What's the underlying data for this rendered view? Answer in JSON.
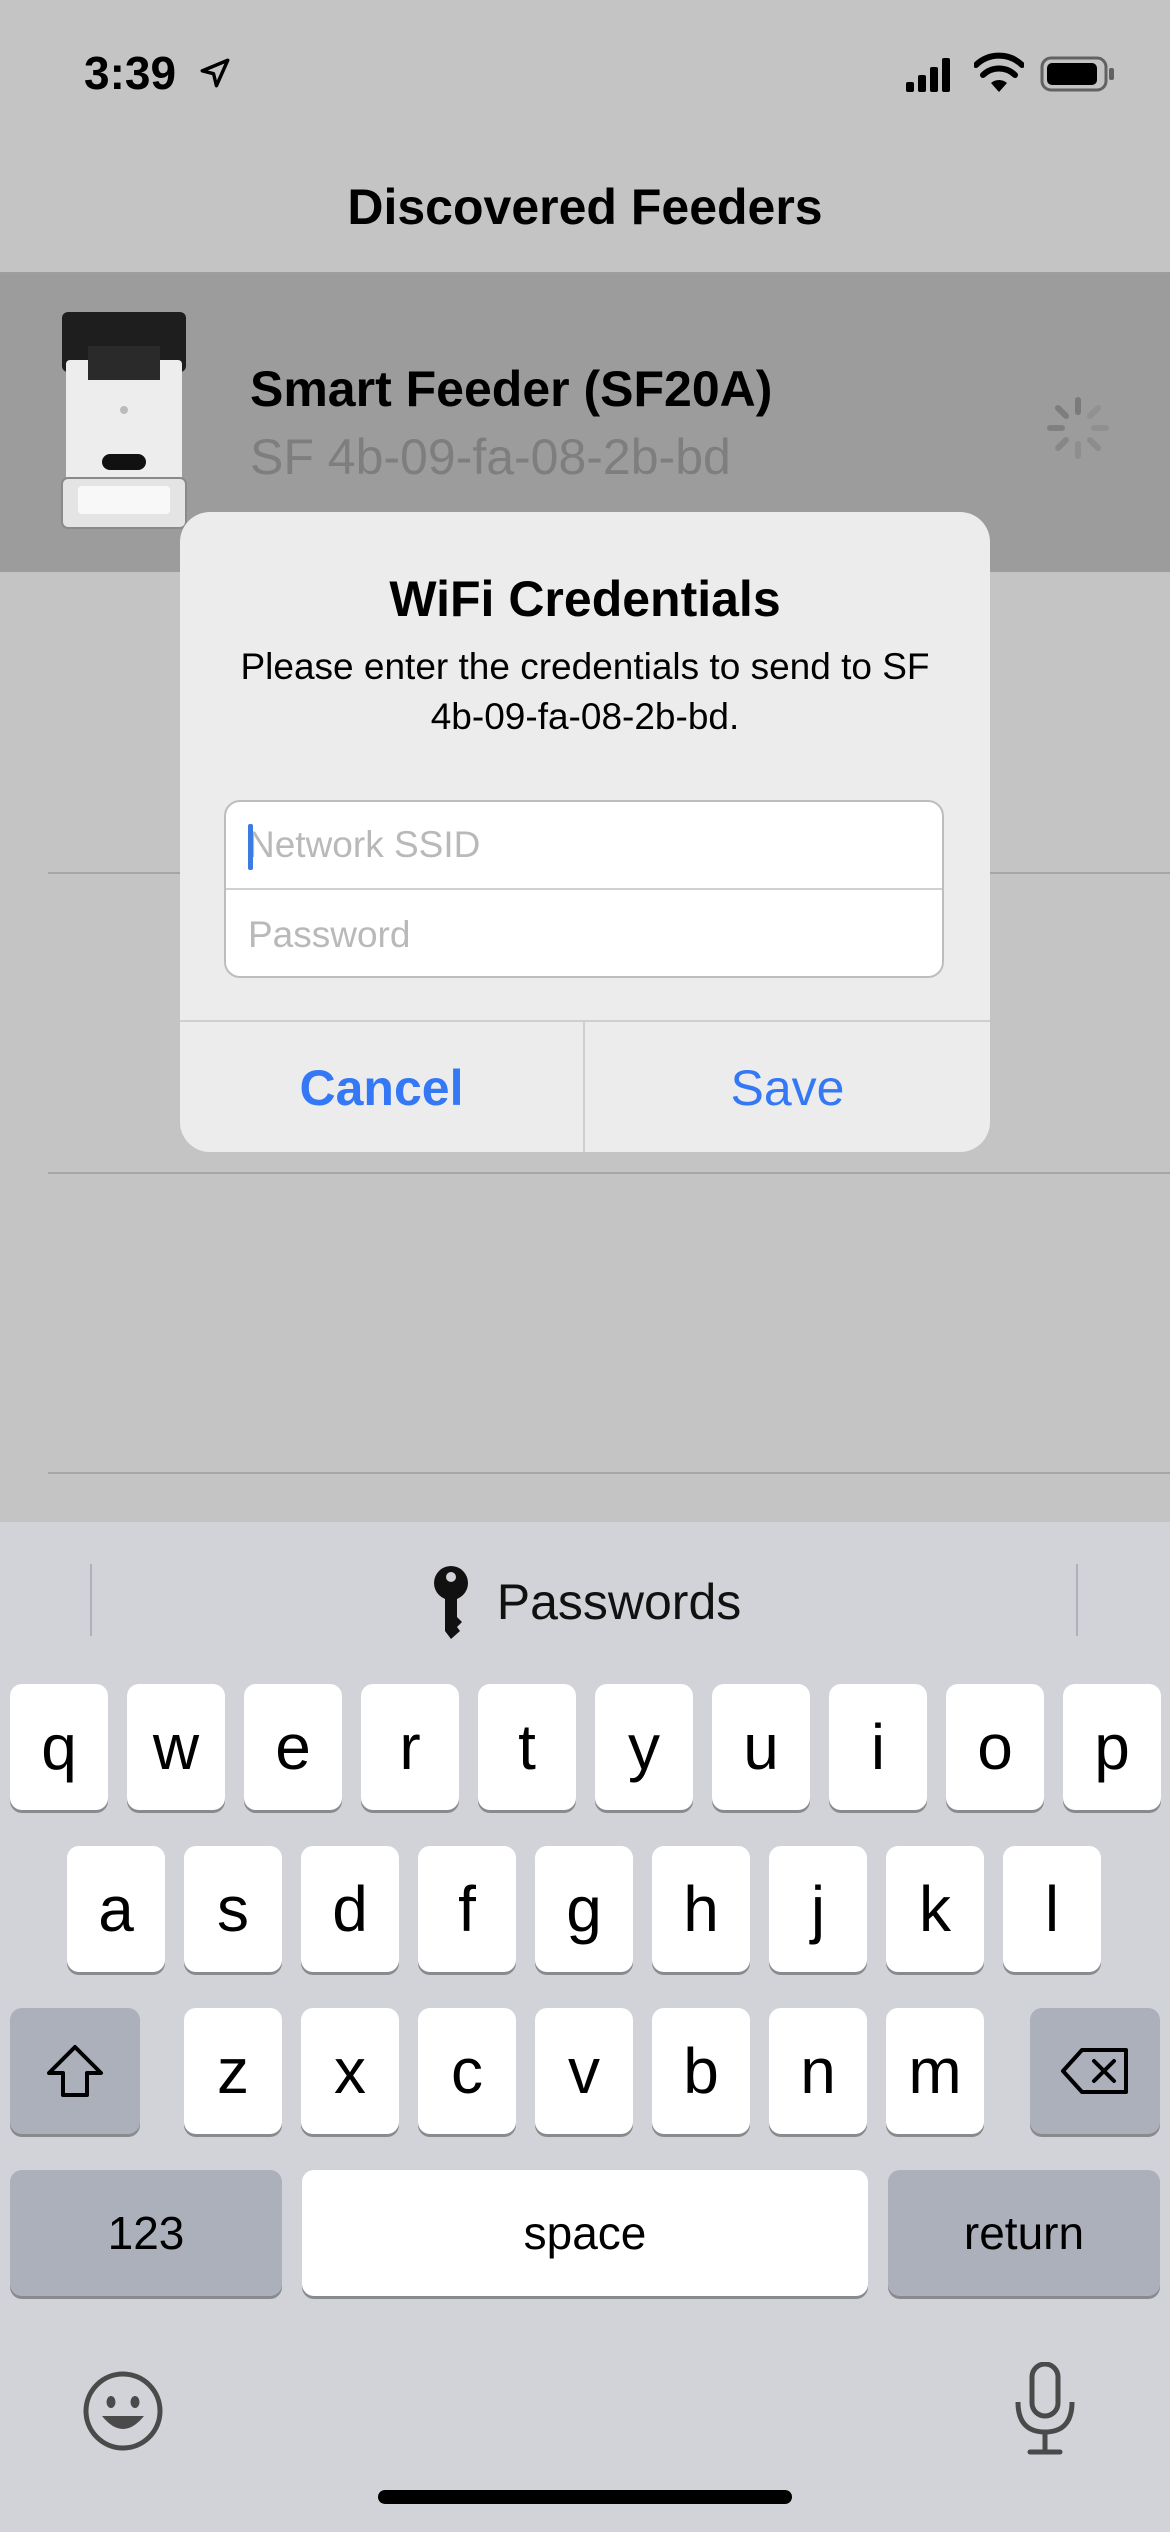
{
  "status_bar": {
    "time": "3:39",
    "icons": [
      "location-arrow-icon",
      "cellular-signal-icon",
      "wifi-icon",
      "battery-icon"
    ]
  },
  "nav": {
    "title": "Discovered Feeders"
  },
  "feeder": {
    "name": "Smart Feeder (SF20A)",
    "mac": "SF 4b-09-fa-08-2b-bd",
    "icon": "loading-spinner-icon"
  },
  "alert": {
    "title": "WiFi Credentials",
    "message": "Please enter the credentials to send to SF 4b-09-fa-08-2b-bd.",
    "ssid_placeholder": "Network SSID",
    "ssid_value": "",
    "password_placeholder": "Password",
    "password_value": "",
    "cancel_label": "Cancel",
    "save_label": "Save"
  },
  "keyboard": {
    "suggestion": "Passwords",
    "row1": [
      "q",
      "w",
      "e",
      "r",
      "t",
      "y",
      "u",
      "i",
      "o",
      "p"
    ],
    "row2": [
      "a",
      "s",
      "d",
      "f",
      "g",
      "h",
      "j",
      "k",
      "l"
    ],
    "row3": [
      "z",
      "x",
      "c",
      "v",
      "b",
      "n",
      "m"
    ],
    "numbers_label": "123",
    "space_label": "space",
    "return_label": "return"
  },
  "colors": {
    "accent": "#3478f6",
    "dim_background": "#c4c4c4",
    "selected_row": "#9c9c9c",
    "keyboard_bg": "#d1d3d9"
  }
}
